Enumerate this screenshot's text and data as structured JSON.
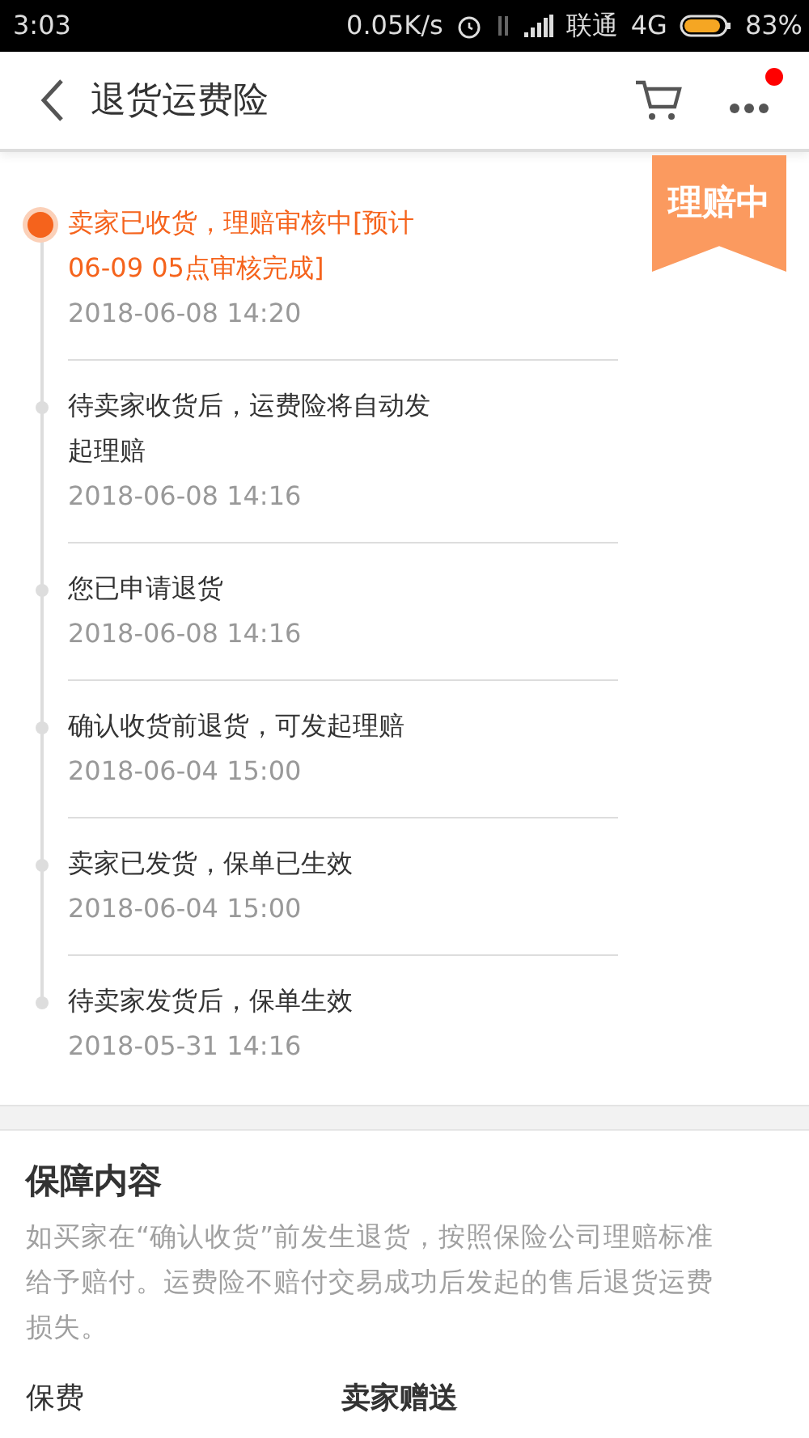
{
  "status_bar": {
    "time": "3:03",
    "net_speed": "0.05K/s",
    "carrier": "联通",
    "network": "4G",
    "battery": "83%"
  },
  "header": {
    "title": "退货运费险",
    "notification_dot": true
  },
  "status_badge": "理赔中",
  "timeline": [
    {
      "text": "卖家已收货，理赔审核中[预计06-09 05点审核完成]",
      "date": "2018-06-08 14:20",
      "current": true
    },
    {
      "text": "待卖家收货后，运费险将自动发起理赔",
      "date": "2018-06-08 14:16",
      "current": false
    },
    {
      "text": "您已申请退货",
      "date": "2018-06-08 14:16",
      "current": false
    },
    {
      "text": "确认收货前退货，可发起理赔",
      "date": "2018-06-04 15:00",
      "current": false
    },
    {
      "text": "卖家已发货，保单已生效",
      "date": "2018-06-04 15:00",
      "current": false
    },
    {
      "text": "待卖家发货后，保单生效",
      "date": "2018-05-31 14:16",
      "current": false
    }
  ],
  "coverage": {
    "title": "保障内容",
    "description": "如买家在“确认收货”前发生退货，按照保险公司理赔标准给予赔付。运费险不赔付交易成功后发起的售后退货运费损失。",
    "rows": [
      {
        "label": "保费",
        "value": "卖家赠送"
      }
    ]
  }
}
